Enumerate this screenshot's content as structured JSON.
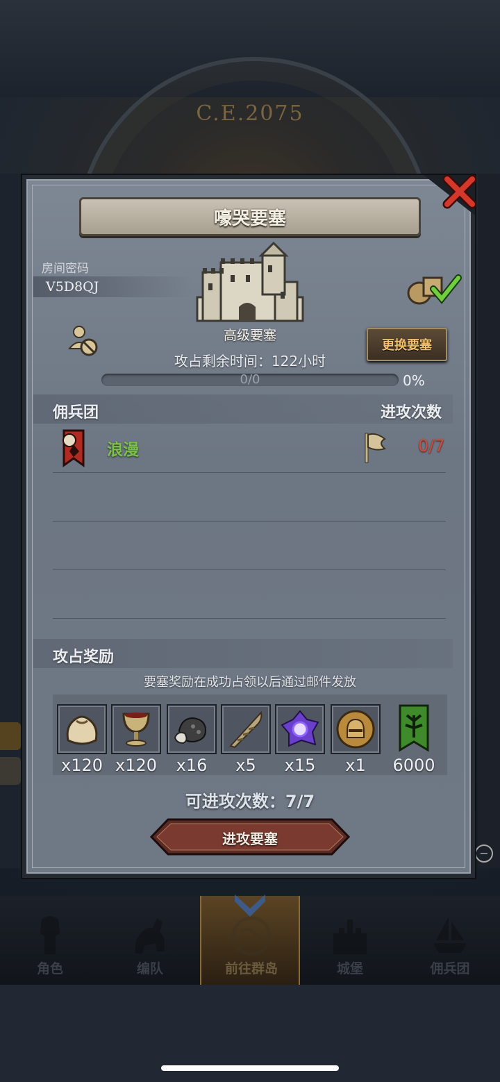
{
  "background": {
    "era": "C.E.2075"
  },
  "dialog": {
    "title": "嚎哭要塞",
    "room_code_label": "房间密码",
    "room_code": "V5D8QJ",
    "fort_grade": "高级要塞",
    "change_fort_label": "更换要塞",
    "time_left": "攻占剩余时间：122小时",
    "progress": {
      "text": "0/0",
      "percent_text": "0%",
      "value": 0
    },
    "mercenary_header": "佣兵团",
    "attack_count_header": "进攻次数",
    "guilds": [
      {
        "name": "浪漫",
        "attacks": "0/7"
      }
    ],
    "rewards_header": "攻占奖励",
    "rewards_note": "要塞奖励在成功占领以后通过邮件发放",
    "rewards": [
      {
        "icon": "sack-icon",
        "qty": "x120"
      },
      {
        "icon": "goblet-icon",
        "qty": "x120"
      },
      {
        "icon": "ore-icon",
        "qty": "x16"
      },
      {
        "icon": "horn-icon",
        "qty": "x5"
      },
      {
        "icon": "crystal-icon",
        "qty": "x15"
      },
      {
        "icon": "helmet-medal-icon",
        "qty": "x1"
      },
      {
        "icon": "guild-banner-icon",
        "qty": "6000"
      }
    ],
    "attacks_available": "可进攻次数：7/7",
    "attack_button_label": "进攻要塞"
  },
  "bottom_nav": [
    {
      "label": "角色",
      "icon": "knight-icon"
    },
    {
      "label": "编队",
      "icon": "horseman-icon"
    },
    {
      "label": "前往群岛",
      "icon": "globe-icon"
    },
    {
      "label": "城堡",
      "icon": "castle-icon"
    },
    {
      "label": "佣兵团",
      "icon": "ship-icon"
    }
  ],
  "colors": {
    "guild_name": "#7cc24a",
    "attack_count": "#d24a3c",
    "change_button_text": "#f3c06a",
    "panel": "#737c89"
  }
}
